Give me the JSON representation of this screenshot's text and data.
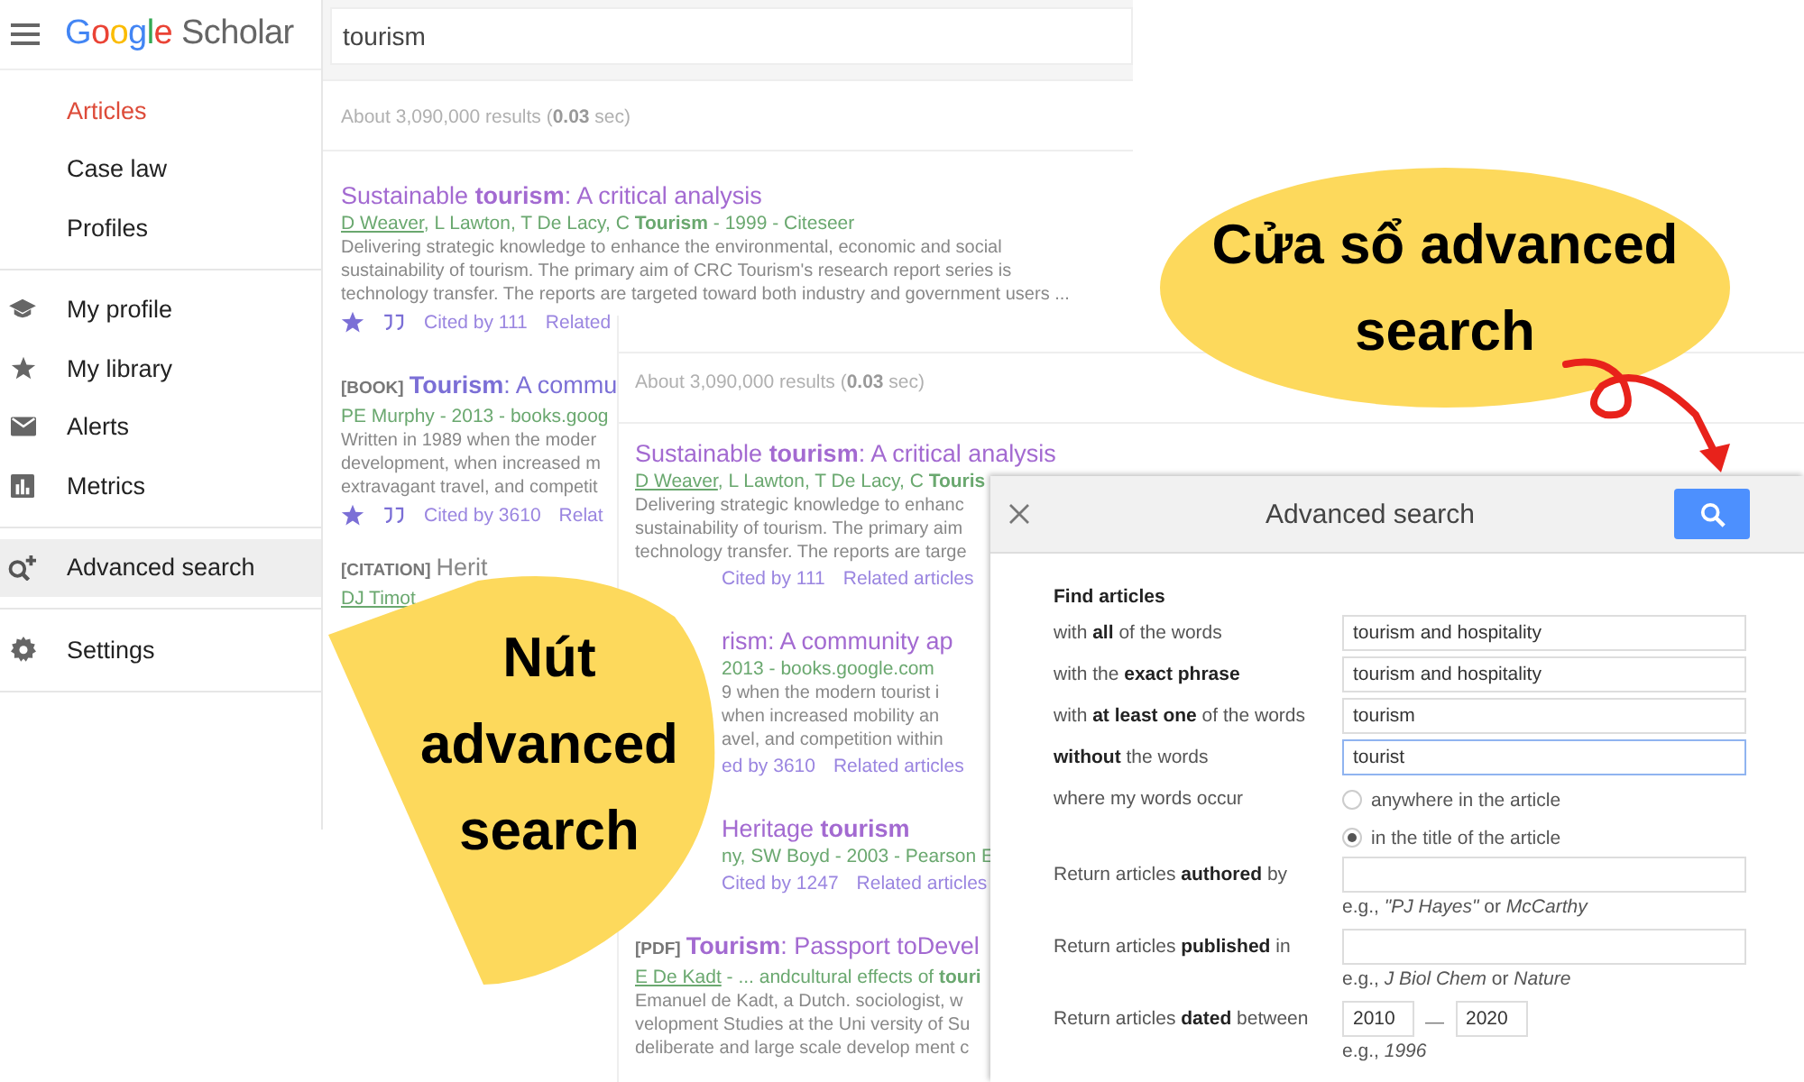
{
  "sidebar": {
    "logo_brand": "Google",
    "logo_product": "Scholar",
    "groups": [
      {
        "items": [
          {
            "label": "Articles",
            "selected": true,
            "highlighted": false
          },
          {
            "label": "Case law",
            "selected": false,
            "highlighted": false
          },
          {
            "label": "Profiles",
            "selected": false,
            "highlighted": false
          }
        ]
      },
      {
        "items": [
          {
            "label": "My profile",
            "selected": false,
            "highlighted": false
          },
          {
            "label": "My library",
            "selected": false,
            "highlighted": false
          },
          {
            "label": "Alerts",
            "selected": false,
            "highlighted": false
          },
          {
            "label": "Metrics",
            "selected": false,
            "highlighted": false
          }
        ]
      },
      {
        "items": [
          {
            "label": "Advanced search",
            "selected": false,
            "highlighted": true
          }
        ]
      },
      {
        "items": [
          {
            "label": "Settings",
            "selected": false,
            "highlighted": false
          }
        ]
      }
    ]
  },
  "back_window": {
    "search_value": "tourism",
    "results_count": "About 3,090,000 results (**0.03** sec)",
    "results": [
      {
        "title": "Sustainable **tourism**: A critical analysis",
        "linked_author": "D Weaver",
        "authors": ", L Lawton, T De Lacy, C **Tourism** - 1999 - Citeseer",
        "snippet": [
          "Delivering strategic knowledge to enhance the environmental, economic and social",
          "sustainability of tourism. The primary aim of CRC Tourism's research report series is",
          "technology transfer. The reports are targeted toward both industry and government users ..."
        ],
        "cited": "Cited by 111",
        "related": "Related"
      },
      {
        "tag": "[BOOK]",
        "title": "**Tourism**: A commu",
        "authors": "PE Murphy - 2013 - books.goog",
        "snippet": [
          "Written in 1989 when the moder",
          "development, when increased m",
          "extravagant travel, and competit"
        ],
        "cited": "Cited by 3610",
        "related": "Relat"
      },
      {
        "tag": "[CITATION]",
        "title": "Herit",
        "linked_author": "DJ Timot"
      }
    ]
  },
  "front_window": {
    "results_count": "About 3,090,000 results (**0.03** sec)",
    "results": [
      {
        "title": "Sustainable **tourism**: A critical analysis",
        "linked_author": "D Weaver",
        "authors": ", L Lawton, T De Lacy, C **Touris**",
        "snippet": [
          "Delivering strategic knowledge to enhanc",
          "sustainability of tourism. The primary aim",
          "technology transfer. The reports are targe"
        ],
        "cited": "Cited by 111",
        "related": "Related articles"
      },
      {
        "title": "rism: A community ap",
        "authors": "2013 - books.google.com",
        "snippet": [
          "9 when the modern tourist i",
          "when increased mobility an",
          "avel, and competition within"
        ],
        "cited": "ed by 3610",
        "related": "Related articles"
      },
      {
        "title": "Heritage **tourism**",
        "authors": "ny, SW Boyd - 2003 - Pearson E",
        "cited": "Cited by 1247",
        "related": "Related articles"
      },
      {
        "tag": "[PDF]",
        "title": "**Tourism**: Passport toDevel",
        "linked_author": "E De Kadt",
        "authors": " - ... andcultural effects of **touri**",
        "snippet": [
          "Emanuel de Kadt, a Dutch. sociologist, w",
          "velopment Studies at the Uni versity of Su",
          "deliberate and large scale develop ment c"
        ]
      }
    ]
  },
  "dialog": {
    "title": "Advanced search",
    "section": "Find articles",
    "fields": [
      {
        "kind": "text",
        "label": "with **all** of the words",
        "value": "tourism and hospitality",
        "focused": false
      },
      {
        "kind": "text",
        "label": "with the **exact phrase**",
        "value": "tourism and hospitality",
        "focused": false
      },
      {
        "kind": "text",
        "label": "with **at least one** of the words",
        "value": "tourism",
        "focused": false
      },
      {
        "kind": "text",
        "label": "**without** the words",
        "value": "tourist",
        "focused": true
      },
      {
        "kind": "radio",
        "label": "where my words occur",
        "options": [
          {
            "label": "anywhere in the article",
            "selected": false
          },
          {
            "label": "in the title of the article",
            "selected": true
          }
        ]
      },
      {
        "kind": "text",
        "label": "Return articles **authored** by",
        "hint": "e.g., *\"PJ Hayes\"* or *McCarthy*",
        "focused": false
      },
      {
        "kind": "text",
        "label": "Return articles **published** in",
        "hint": "e.g., *J Biol Chem* or *Nature*",
        "focused": false
      },
      {
        "kind": "range",
        "label": "Return articles **dated** between",
        "from": "2010",
        "separator": "—",
        "to": "2020",
        "hint": "e.g., *1996*"
      }
    ]
  },
  "callouts": [
    {
      "text": "Cửa sổ advanced search"
    },
    {
      "text": "Nút advanced search"
    }
  ]
}
